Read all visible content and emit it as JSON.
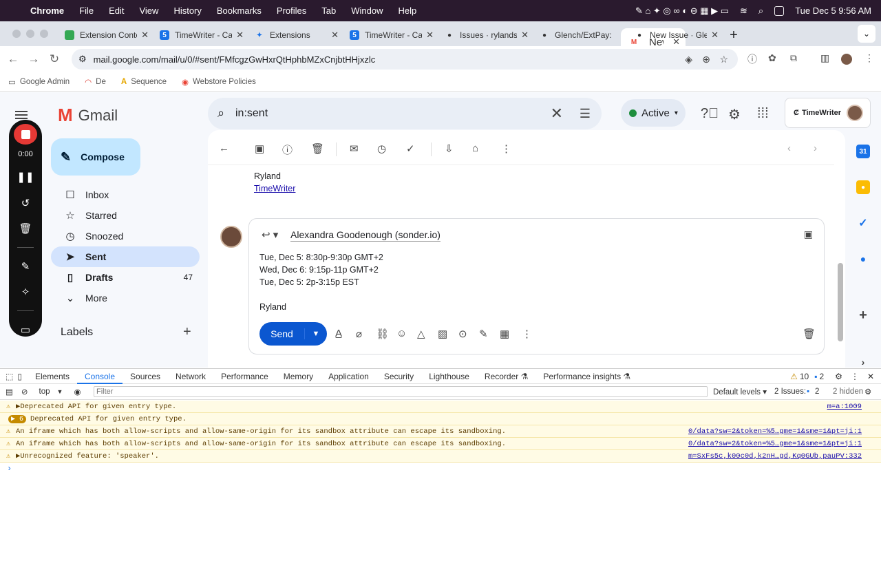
{
  "menubar": {
    "app": "Chrome",
    "items": [
      "File",
      "Edit",
      "View",
      "History",
      "Bookmarks",
      "Profiles",
      "Tab",
      "Window",
      "Help"
    ],
    "datetime": "Tue Dec 5  9:56 AM"
  },
  "tabs": [
    {
      "title": "Extension Conte",
      "fav": "",
      "color": "#34a853"
    },
    {
      "title": "New (old-schoo",
      "fav": "M",
      "color": "#ea4335"
    },
    {
      "title": "TimeWriter - Ca",
      "fav": "5",
      "color": "#1a73e8"
    },
    {
      "title": "Extensions",
      "fav": "✦",
      "color": "#1a73e8"
    },
    {
      "title": "TimeWriter - Ca",
      "fav": "5",
      "color": "#1a73e8"
    },
    {
      "title": "Issues · rylandsi",
      "fav": "●",
      "color": "#111"
    },
    {
      "title": "Glench/ExtPay:",
      "fav": "●",
      "color": "#111"
    },
    {
      "title": "New Issue · Glen",
      "fav": "●",
      "color": "#111"
    }
  ],
  "address": {
    "url": "mail.google.com/mail/u/0/#sent/FMfcgzGwHxrQtHphbMZxCnjbtHHjxzlc"
  },
  "bookmarks": [
    "Google Admin",
    "De",
    "Sequence",
    "Webstore Policies"
  ],
  "gmail": {
    "brand": "Gmail",
    "search": "in:sent",
    "status": "Active",
    "account_label": "TimeWriter",
    "compose": "Compose",
    "nav": [
      {
        "label": "Inbox",
        "icon": "☐",
        "count": ""
      },
      {
        "label": "Starred",
        "icon": "☆",
        "count": ""
      },
      {
        "label": "Snoozed",
        "icon": "◷",
        "count": ""
      },
      {
        "label": "Sent",
        "icon": "➤",
        "count": ""
      },
      {
        "label": "Drafts",
        "icon": "▯",
        "count": "47"
      },
      {
        "label": "More",
        "icon": "⌄",
        "count": ""
      }
    ],
    "labels": "Labels",
    "recorder": {
      "time": "0:00"
    },
    "message": {
      "sig_name": "Ryland",
      "sig_link": "TimeWriter"
    },
    "reply": {
      "to": "Alexandra Goodenough (sonder.io)",
      "lines": [
        "Tue, Dec 5: 8:30p-9:30p GMT+2",
        "Wed, Dec 6: 9:15p-11p GMT+2",
        "Tue, Dec 5: 2p-3:15p EST",
        "",
        "Ryland"
      ],
      "send": "Send"
    }
  },
  "devtools": {
    "tabs": [
      "Elements",
      "Console",
      "Sources",
      "Network",
      "Performance",
      "Memory",
      "Application",
      "Security",
      "Lighthouse",
      "Recorder ⚗",
      "Performance insights ⚗"
    ],
    "warn_count": "10",
    "info_count": "2",
    "context": "top",
    "filter_placeholder": "Filter",
    "levels": "Default levels ▾",
    "issues": "2 Issues:",
    "issues_n": "2",
    "hidden": "2 hidden",
    "rows": [
      {
        "badge": "",
        "text": "▶Deprecated API for given entry type.",
        "src": "m=a:1009"
      },
      {
        "badge": "▶ 6",
        "text": "Deprecated API for given entry type.",
        "src": ""
      },
      {
        "badge": "",
        "text": "An iframe which has both allow-scripts and allow-same-origin for its sandbox attribute can escape its sandboxing.",
        "src": "0/data?sw=2&token=%5…gme=1&sme=1&pt=ji:1"
      },
      {
        "badge": "",
        "text": "An iframe which has both allow-scripts and allow-same-origin for its sandbox attribute can escape its sandboxing.",
        "src": "0/data?sw=2&token=%5…gme=1&sme=1&pt=ji:1"
      },
      {
        "badge": "",
        "text": "▶Unrecognized feature: 'speaker'.",
        "src": "m=SxFs5c,k00c0d,k2nH…gd,Kq0GUb,pauPV:332"
      }
    ]
  }
}
